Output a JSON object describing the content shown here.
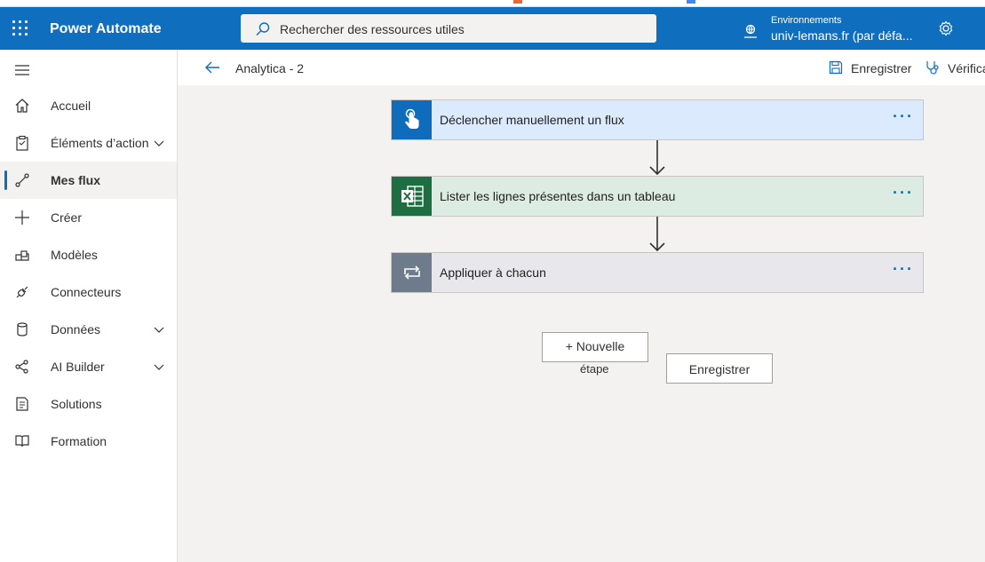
{
  "header": {
    "app_name": "Power Automate",
    "search_placeholder": "Rechercher des ressources utiles",
    "env_label": "Environnements",
    "env_value": "univ-lemans.fr (par défa..."
  },
  "sidebar": {
    "items": [
      {
        "label": "Accueil"
      },
      {
        "label": "Éléments d’action"
      },
      {
        "label": "Mes flux"
      },
      {
        "label": "Créer"
      },
      {
        "label": "Modèles"
      },
      {
        "label": "Connecteurs"
      },
      {
        "label": "Données"
      },
      {
        "label": "AI Builder"
      },
      {
        "label": "Solutions"
      },
      {
        "label": "Formation"
      }
    ]
  },
  "command_bar": {
    "flow_name": "Analytica - 2",
    "save_label": "Enregistrer",
    "verify_label": "Vérifica"
  },
  "flow": {
    "steps": [
      {
        "title": "Déclencher manuellement un flux",
        "more": "···"
      },
      {
        "title": "Lister les lignes présentes dans un tableau",
        "more": "···"
      },
      {
        "title": "Appliquer à chacun",
        "more": "···"
      }
    ],
    "new_step_label": "+ Nouvelle",
    "new_step_label_2": "étape",
    "save_button": "Enregistrer"
  },
  "colors": {
    "brand": "#106ebe",
    "trigger": "#0f6cbd",
    "excel": "#1d6f42",
    "control": "#6e7b8b"
  }
}
